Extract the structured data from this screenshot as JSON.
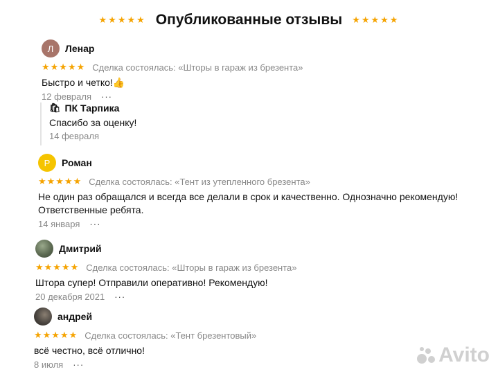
{
  "header": {
    "title": "Опубликованные отзывы",
    "stars": "★★★★★"
  },
  "reviews": [
    {
      "author": "Ленар",
      "avatar_letter": "Л",
      "avatar_color": "#a8756a",
      "stars": "★★★★★",
      "deal": "Сделка состоялась: «Шторы в гараж из брезента»",
      "text": "Быстро и четко!👍",
      "date": "12 февраля",
      "more": "···",
      "reply": {
        "shop_icon": "🛍",
        "author": "ПК Тарпика",
        "text": "Спасибо за оценку!",
        "date": "14 февраля"
      }
    },
    {
      "author": "Роман",
      "avatar_letter": "Р",
      "avatar_color": "#f5c400",
      "stars": "★★★★★",
      "deal": "Сделка состоялась: «Тент из утепленного брезента»",
      "text": "Не один раз обращался и всегда все делали в срок и качественно. Однозначно рекомендую! Ответственные ребята.",
      "date": "14 января",
      "more": "···"
    },
    {
      "author": "Дмитрий",
      "avatar_letter": "",
      "avatar_color": "#5d6b52",
      "stars": "★★★★★",
      "deal": "Сделка состоялась: «Шторы в гараж из брезента»",
      "text": "Штора супер! Отправили оперативно! Рекомендую!",
      "date": "20 декабря 2021",
      "more": "···"
    },
    {
      "author": "андрей",
      "avatar_letter": "",
      "avatar_color": "#4a4540",
      "stars": "★★★★★",
      "deal": "Сделка состоялась: «Тент брезентовый»",
      "text": "всё честно, всё отлично!",
      "date": "8 июля",
      "more": "···"
    }
  ],
  "watermark": {
    "text": "Avito"
  },
  "colors": {
    "star": "#f5a300",
    "muted": "#888888"
  }
}
